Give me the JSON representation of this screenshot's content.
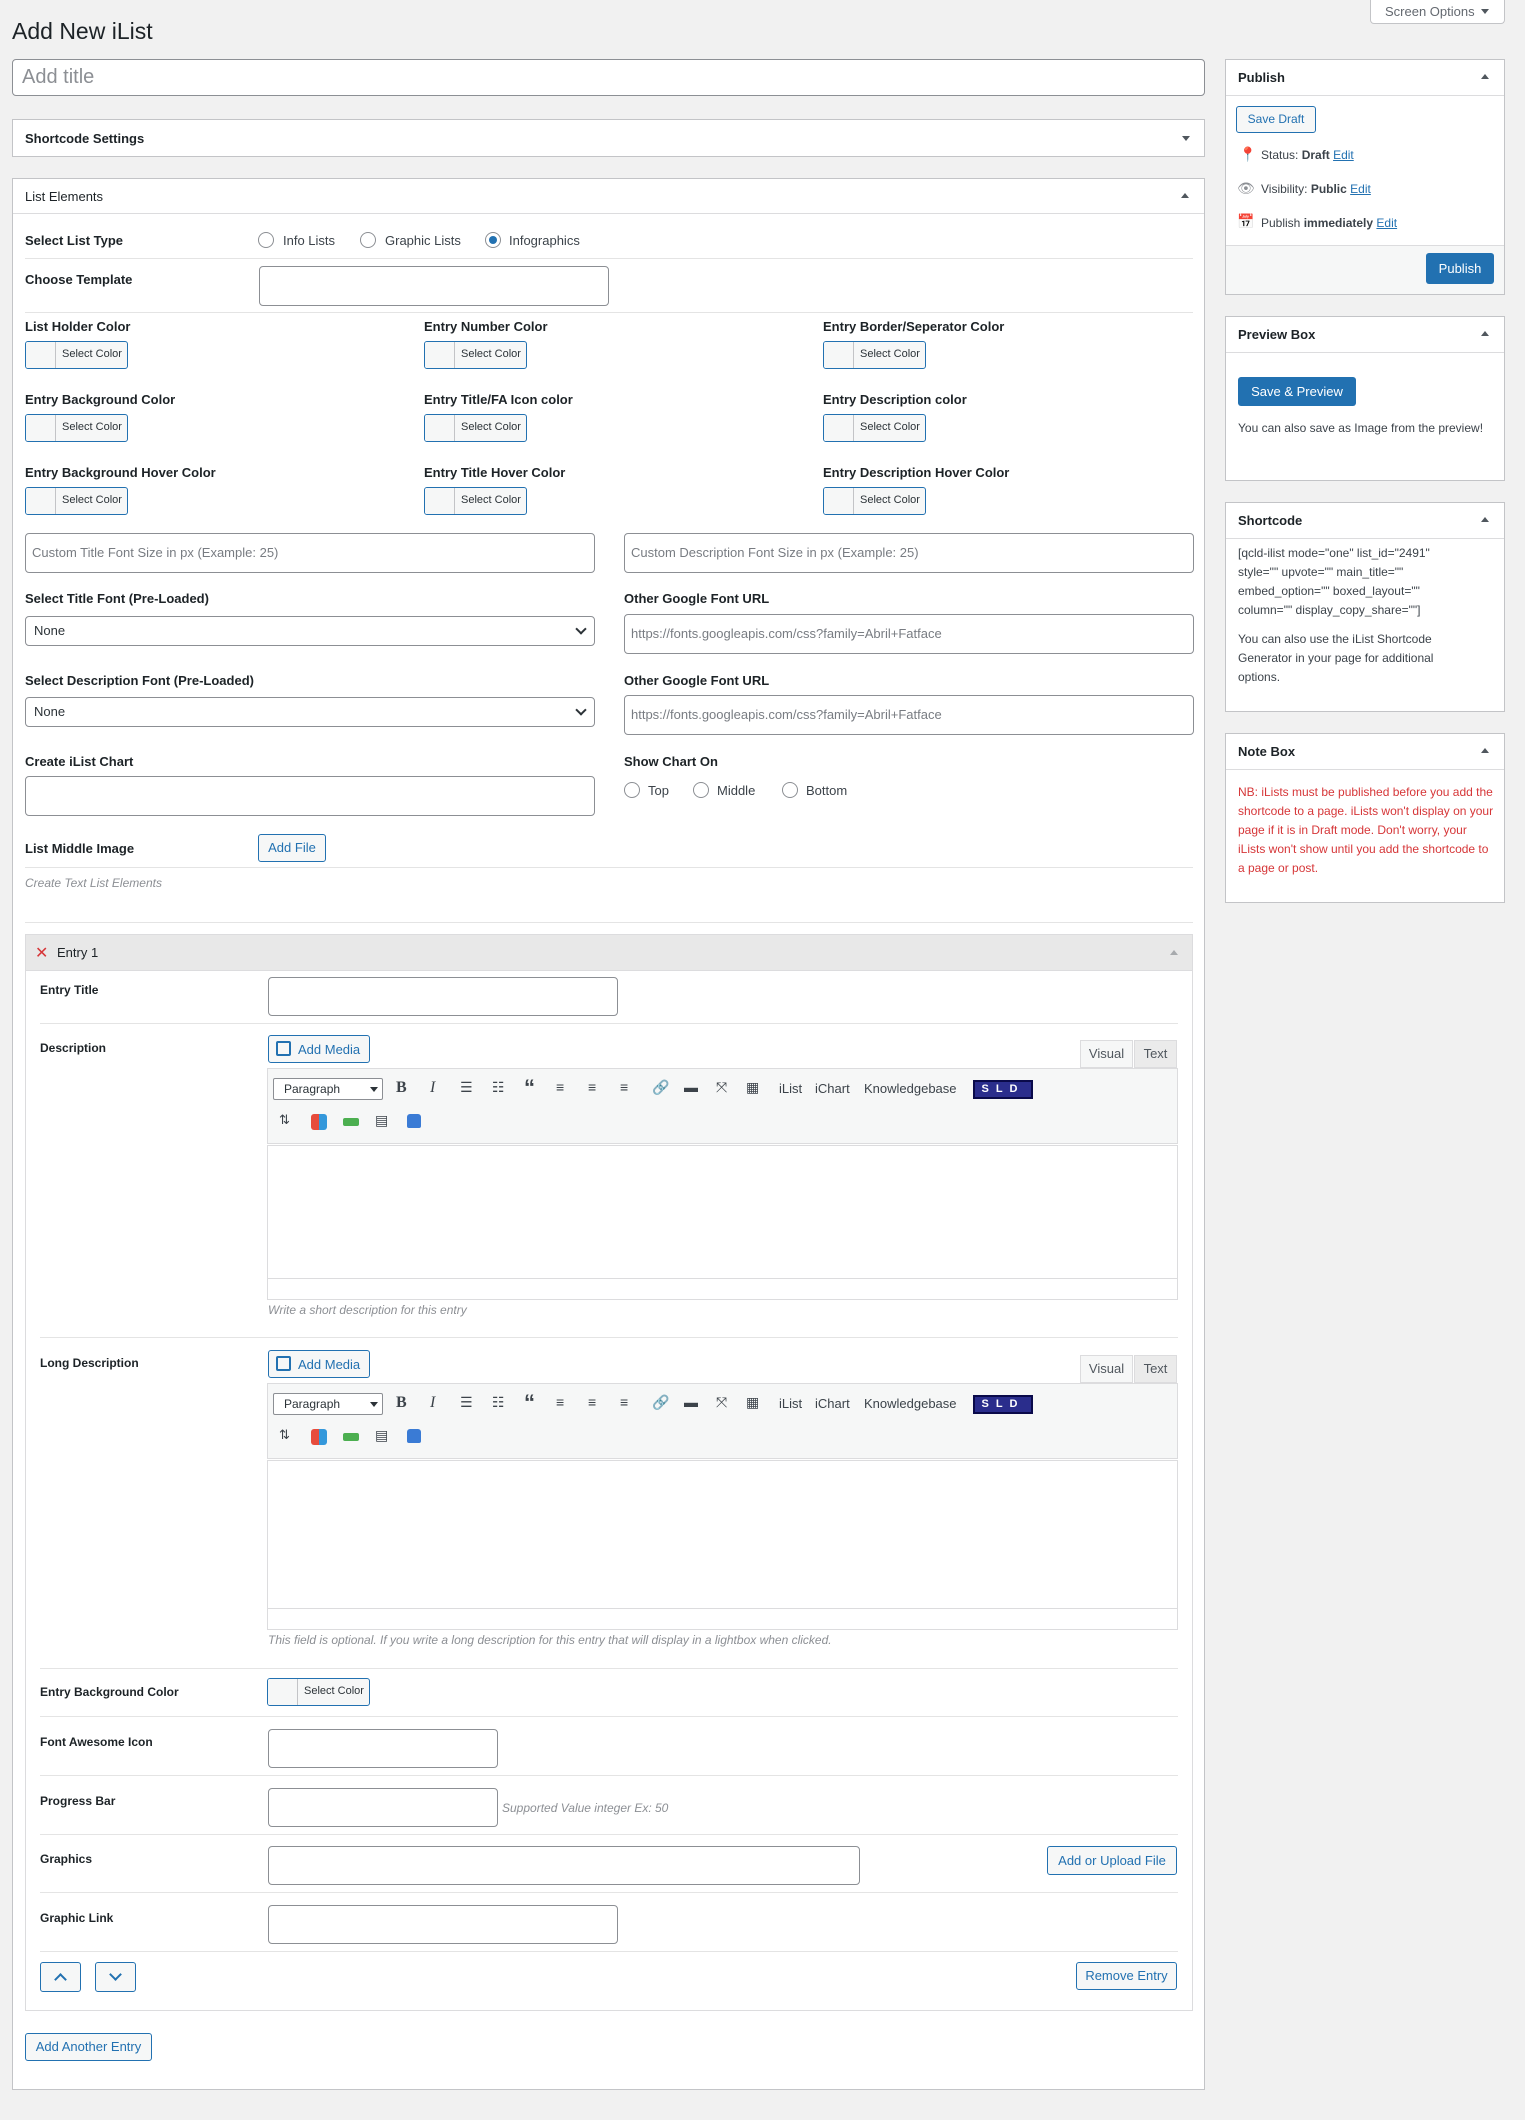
{
  "page": {
    "heading": "Add New iList",
    "screen_options": "Screen Options",
    "title_placeholder": "Add title"
  },
  "shortcode_settings": {
    "title": "Shortcode Settings"
  },
  "list_elements": {
    "title": "List Elements",
    "list_type_label": "Select List Type",
    "list_types": [
      "Info Lists",
      "Graphic Lists",
      "Infographics"
    ],
    "list_type_selected": "Infographics",
    "template_label": "Choose Template",
    "colors": [
      "List Holder Color",
      "Entry Number Color",
      "Entry Border/Seperator Color",
      "Entry Background Color",
      "Entry Title/FA Icon color",
      "Entry Description color",
      "Entry Background Hover Color",
      "Entry Title Hover Color",
      "Entry Description Hover Color"
    ],
    "select_color": "Select Color",
    "title_font_size_placeholder": "Custom Title Font Size in px (Example: 25)",
    "desc_font_size_placeholder": "Custom Description Font Size in px (Example: 25)",
    "title_font_label": "Select Title Font (Pre-Loaded)",
    "title_font_value": "None",
    "google_font_label": "Other Google Font URL",
    "google_font_placeholder": "https://fonts.googleapis.com/css?family=Abril+Fatface",
    "desc_font_label": "Select Description Font (Pre-Loaded)",
    "desc_font_value": "None",
    "google_font_label2": "Other Google Font URL",
    "google_font_placeholder2": "https://fonts.googleapis.com/css?family=Abril+Fatface",
    "chart_label": "Create iList Chart",
    "show_chart_label": "Show Chart On",
    "chart_positions": [
      "Top",
      "Middle",
      "Bottom"
    ],
    "middle_image_label": "List Middle Image",
    "add_file": "Add File",
    "create_text_elements": "Create Text List Elements"
  },
  "entry": {
    "title": "Entry 1",
    "entry_title_label": "Entry Title",
    "description_label": "Description",
    "long_description_label": "Long Description",
    "add_media": "Add Media",
    "tab_visual": "Visual",
    "tab_text": "Text",
    "paragraph": "Paragraph",
    "toolbar_words": [
      "iList",
      "iChart",
      "Knowledgebase"
    ],
    "sld": "SLD",
    "desc_hint": "Write a short description for this entry",
    "long_desc_hint": "This field is optional. If you write a long description for this entry that will display in a lightbox when clicked.",
    "bg_color_label": "Entry Background Color",
    "select_color": "Select Color",
    "fa_icon_label": "Font Awesome Icon",
    "progress_label": "Progress Bar",
    "progress_hint": "Supported Value integer Ex: 50",
    "graphics_label": "Graphics",
    "add_upload": "Add or Upload File",
    "graphic_link_label": "Graphic Link",
    "remove_entry": "Remove Entry",
    "add_another": "Add Another Entry"
  },
  "publish": {
    "title": "Publish",
    "save_draft": "Save Draft",
    "status_label": "Status:",
    "status_value": "Draft",
    "visibility_label": "Visibility:",
    "visibility_value": "Public",
    "publish_label": "Publish",
    "publish_value": "immediately",
    "edit": "Edit",
    "publish_button": "Publish"
  },
  "preview_box": {
    "title": "Preview Box",
    "button": "Save & Preview",
    "text": "You can also save as Image from the preview!"
  },
  "shortcode_box": {
    "title": "Shortcode",
    "code": "[qcld-ilist mode=\"one\" list_id=\"2491\" style=\"\" upvote=\"\" main_title=\"\" embed_option=\"\" boxed_layout=\"\" column=\"\" display_copy_share=\"\"]",
    "text": "You can also use the iList Shortcode Generator in your page for additional options."
  },
  "note_box": {
    "title": "Note Box",
    "text": "NB: iLists must be published before you add the shortcode to a page. iLists won't display on your page if it is in Draft mode. Don't worry, your iLists won't show until you add the shortcode to a page or post."
  },
  "colors": {
    "accent": "#2271b1",
    "note": "#d63638",
    "sld_bg": "#2a2d8c"
  }
}
